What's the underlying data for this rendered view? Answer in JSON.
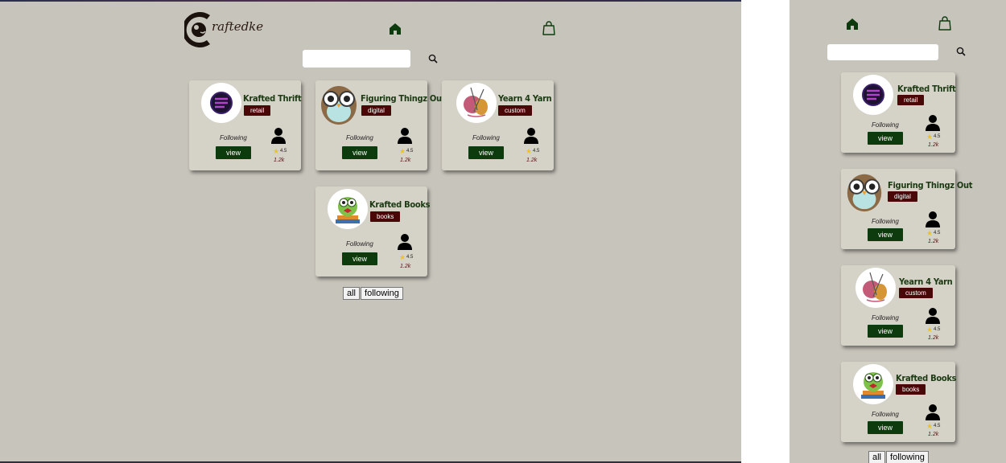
{
  "brand": {
    "logo_text": "raftedke"
  },
  "nav": {
    "home_icon": "home-icon",
    "cart_icon": "shopping-bag-icon"
  },
  "search": {
    "placeholder": "",
    "icon": "search-icon"
  },
  "shops": [
    {
      "name": "Krafted Thrift",
      "category": "retail",
      "following_label": "Following",
      "view_label": "view",
      "rating": "4.5",
      "count": "1.2k",
      "avatar": "thrift-logo"
    },
    {
      "name": "Figuring Thingz Out",
      "category": "digital",
      "following_label": "Following",
      "view_label": "view",
      "rating": "4.5",
      "count": "1.2k",
      "avatar": "owl-logo"
    },
    {
      "name": "Yearn 4 Yarn",
      "category": "custom",
      "following_label": "Following",
      "view_label": "view",
      "rating": "4.5",
      "count": "1.2k",
      "avatar": "yarn-logo"
    },
    {
      "name": "Krafted Books",
      "category": "books",
      "following_label": "Following",
      "view_label": "view",
      "rating": "4.5",
      "count": "1.2k",
      "avatar": "books-logo"
    }
  ],
  "filters": [
    "all",
    "following"
  ],
  "colors": {
    "background": "#c7c4bb",
    "card": "#d5d2c8",
    "badge": "#4a0707",
    "button": "#0d3b0d",
    "star": "#f3c11b"
  }
}
